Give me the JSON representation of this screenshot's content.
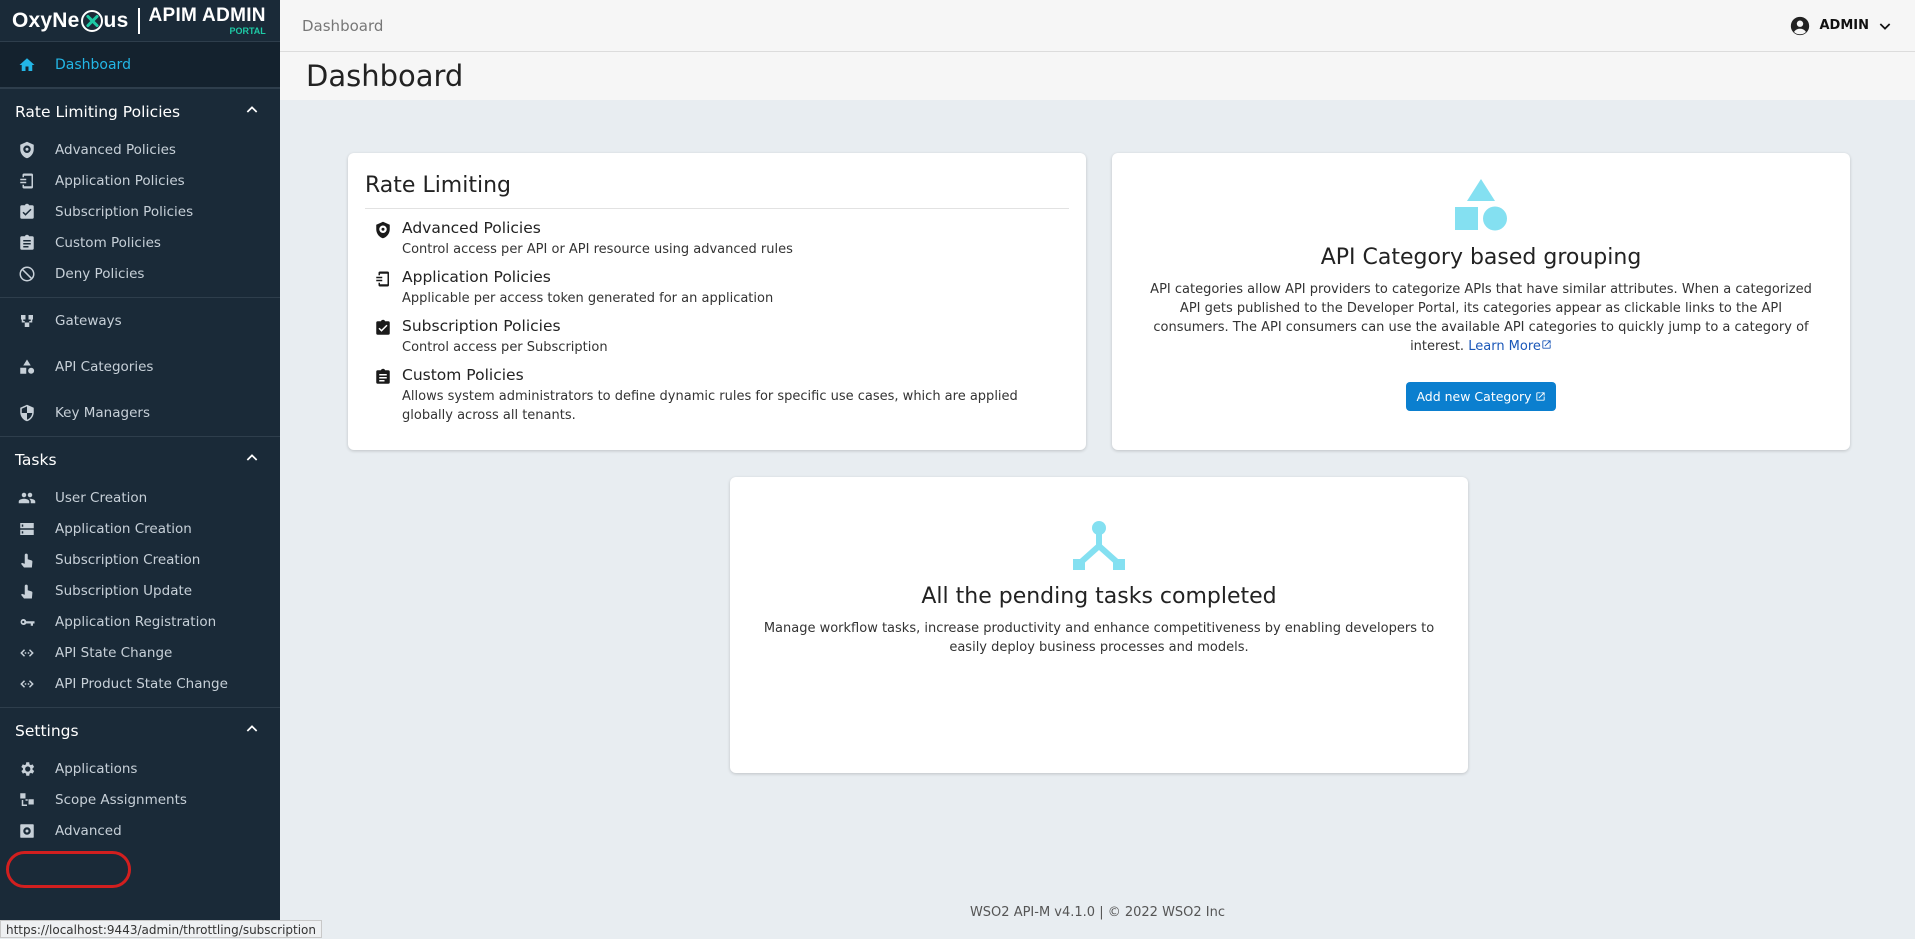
{
  "brand": {
    "name_part1": "OxyNe",
    "name_part2": "us",
    "product": "APIM ADMIN",
    "product_sub": "PORTAL",
    "accent": "#1ec9a5"
  },
  "sidebar": {
    "dashboard": {
      "label": "Dashboard",
      "icon": "home-icon"
    },
    "rate_limiting": {
      "title": "Rate Limiting Policies",
      "items": [
        {
          "label": "Advanced Policies",
          "icon": "advanced-policy-icon"
        },
        {
          "label": "Application Policies",
          "icon": "application-policy-icon"
        },
        {
          "label": "Subscription Policies",
          "icon": "subscription-policy-icon"
        },
        {
          "label": "Custom Policies",
          "icon": "custom-policy-icon"
        },
        {
          "label": "Deny Policies",
          "icon": "deny-icon"
        }
      ]
    },
    "standalone": [
      {
        "label": "Gateways",
        "icon": "gateways-icon"
      },
      {
        "label": "API Categories",
        "icon": "categories-icon"
      },
      {
        "label": "Key Managers",
        "icon": "key-manager-icon"
      }
    ],
    "tasks": {
      "title": "Tasks",
      "items": [
        {
          "label": "User Creation",
          "icon": "users-icon"
        },
        {
          "label": "Application Creation",
          "icon": "application-creation-icon"
        },
        {
          "label": "Subscription Creation",
          "icon": "subscription-creation-icon"
        },
        {
          "label": "Subscription Update",
          "icon": "subscription-update-icon"
        },
        {
          "label": "Application Registration",
          "icon": "key-icon"
        },
        {
          "label": "API State Change",
          "icon": "state-change-icon"
        },
        {
          "label": "API Product State Change",
          "icon": "product-state-change-icon"
        }
      ]
    },
    "settings": {
      "title": "Settings",
      "items": [
        {
          "label": "Applications",
          "icon": "gear-icon"
        },
        {
          "label": "Scope Assignments",
          "icon": "scope-icon"
        },
        {
          "label": "Advanced",
          "icon": "advanced-settings-icon"
        }
      ]
    },
    "status_url": "https://localhost:9443/admin/throttling/subscription"
  },
  "topbar": {
    "breadcrumb": "Dashboard",
    "user": "ADMIN"
  },
  "page": {
    "title": "Dashboard"
  },
  "rate_card": {
    "title": "Rate Limiting",
    "rows": [
      {
        "name": "Advanced Policies",
        "desc": "Control access per API or API resource using advanced rules"
      },
      {
        "name": "Application Policies",
        "desc": "Applicable per access token generated for an application"
      },
      {
        "name": "Subscription Policies",
        "desc": "Control access per Subscription"
      },
      {
        "name": "Custom Policies",
        "desc": "Allows system administrators to define dynamic rules for specific use cases, which are applied globally across all tenants."
      }
    ]
  },
  "category_card": {
    "title": "API Category based grouping",
    "desc": "API categories allow API providers to categorize APIs that have similar attributes. When a categorized API gets published to the Developer Portal, its categories appear as clickable links to the API consumers. The API consumers can use the available API categories to quickly jump to a category of interest.",
    "learn_more": "Learn More",
    "button": "Add new Category",
    "icon_color": "#84e0f1"
  },
  "tasks_card": {
    "title": "All the pending tasks completed",
    "desc": "Manage workflow tasks, increase productivity and enhance competitiveness by enabling developers to easily deploy business processes and models."
  },
  "footer": {
    "text": "WSO2 API-M v4.1.0 | © 2022 WSO2 Inc"
  }
}
